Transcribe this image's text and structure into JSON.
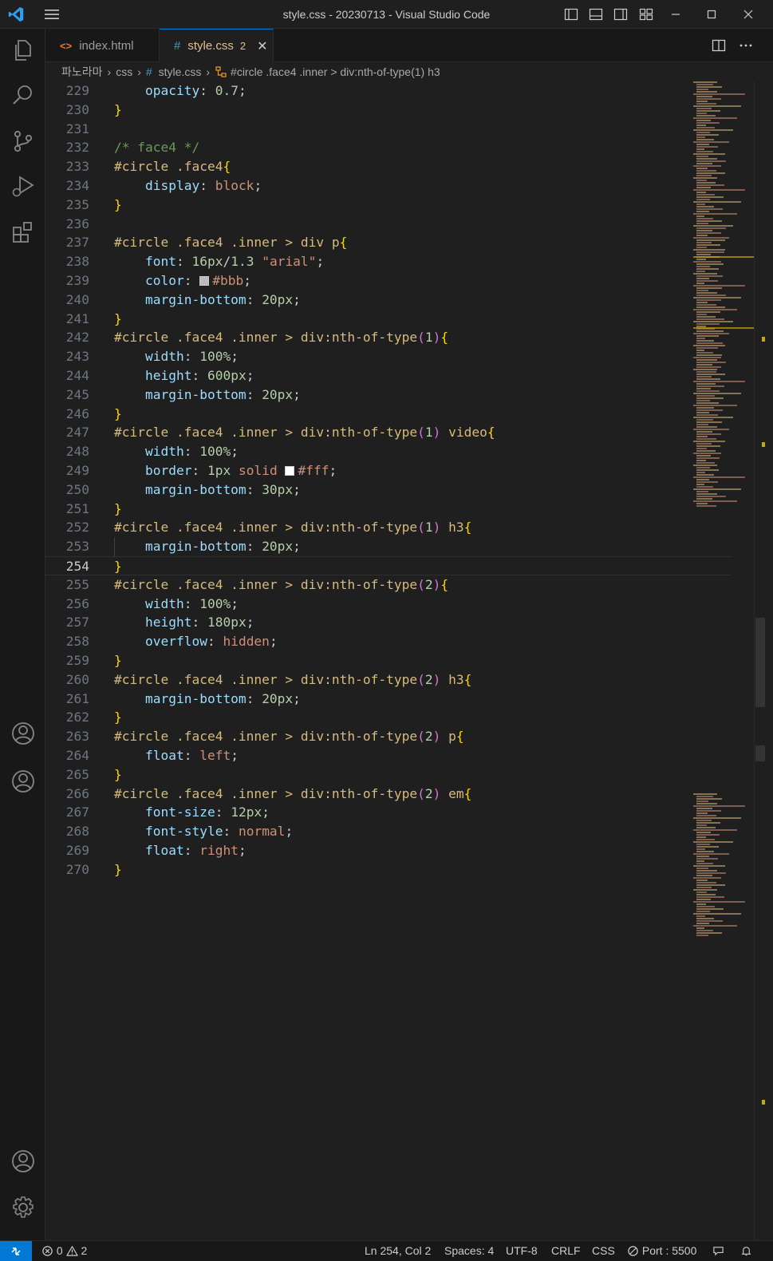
{
  "window": {
    "title": "style.css - 20230713 - Visual Studio Code"
  },
  "tabs": [
    {
      "label": "index.html",
      "icon": "html-file-icon"
    },
    {
      "label": "style.css",
      "icon": "css-file-icon",
      "problems": "2",
      "active": true
    }
  ],
  "breadcrumb": {
    "items": [
      "파노라마",
      "css",
      "style.css",
      "#circle .face4 .inner > div:nth-of-type(1) h3"
    ]
  },
  "editor": {
    "current_line": "254",
    "lines": [
      {
        "n": "229"
      },
      {
        "n": "230"
      },
      {
        "n": "231"
      },
      {
        "n": "232"
      },
      {
        "n": "233"
      },
      {
        "n": "234"
      },
      {
        "n": "235"
      },
      {
        "n": "236"
      },
      {
        "n": "237"
      },
      {
        "n": "238"
      },
      {
        "n": "239"
      },
      {
        "n": "240"
      },
      {
        "n": "241"
      },
      {
        "n": "242"
      },
      {
        "n": "243"
      },
      {
        "n": "244"
      },
      {
        "n": "245"
      },
      {
        "n": "246"
      },
      {
        "n": "247"
      },
      {
        "n": "248"
      },
      {
        "n": "249"
      },
      {
        "n": "250"
      },
      {
        "n": "251"
      },
      {
        "n": "252"
      },
      {
        "n": "253"
      },
      {
        "n": "254"
      },
      {
        "n": "255"
      },
      {
        "n": "256"
      },
      {
        "n": "257"
      },
      {
        "n": "258"
      },
      {
        "n": "259"
      },
      {
        "n": "260"
      },
      {
        "n": "261"
      },
      {
        "n": "262"
      },
      {
        "n": "263"
      },
      {
        "n": "264"
      },
      {
        "n": "265"
      },
      {
        "n": "266"
      },
      {
        "n": "267"
      },
      {
        "n": "268"
      },
      {
        "n": "269"
      },
      {
        "n": "270"
      }
    ],
    "code": [
      [
        [
          "prop",
          "    opacity"
        ],
        [
          "punc",
          ": "
        ],
        [
          "num",
          "0.7"
        ],
        [
          "punc",
          ";"
        ]
      ],
      [
        [
          "brace",
          "}"
        ]
      ],
      [],
      [
        [
          "cmt",
          "/* face4 */"
        ]
      ],
      [
        [
          "sel",
          "#circle .face4"
        ],
        [
          "brace",
          "{"
        ]
      ],
      [
        [
          "prop",
          "    display"
        ],
        [
          "punc",
          ": "
        ],
        [
          "kw",
          "block"
        ],
        [
          "punc",
          ";"
        ]
      ],
      [
        [
          "brace",
          "}"
        ]
      ],
      [],
      [
        [
          "sel",
          "#circle .face4 .inner > div p"
        ],
        [
          "brace",
          "{"
        ]
      ],
      [
        [
          "prop",
          "    font"
        ],
        [
          "punc",
          ": "
        ],
        [
          "num",
          "16px"
        ],
        [
          "punc",
          "/"
        ],
        [
          "num",
          "1.3"
        ],
        [
          "punc",
          " "
        ],
        [
          "str",
          "\"arial\""
        ],
        [
          "punc",
          ";"
        ]
      ],
      [
        [
          "prop",
          "    color"
        ],
        [
          "punc",
          ": "
        ],
        [
          "swatch",
          "#bbbbbb"
        ],
        [
          "str",
          "#bbb"
        ],
        [
          "punc",
          ";"
        ]
      ],
      [
        [
          "prop",
          "    margin-bottom"
        ],
        [
          "punc",
          ": "
        ],
        [
          "num",
          "20px"
        ],
        [
          "punc",
          ";"
        ]
      ],
      [
        [
          "brace",
          "}"
        ]
      ],
      [
        [
          "sel",
          "#circle .face4 .inner > div:nth-of-type"
        ],
        [
          "paren",
          "("
        ],
        [
          "num",
          "1"
        ],
        [
          "paren",
          ")"
        ],
        [
          "brace",
          "{"
        ]
      ],
      [
        [
          "prop",
          "    width"
        ],
        [
          "punc",
          ": "
        ],
        [
          "num",
          "100%"
        ],
        [
          "punc",
          ";"
        ]
      ],
      [
        [
          "prop",
          "    height"
        ],
        [
          "punc",
          ": "
        ],
        [
          "num",
          "600px"
        ],
        [
          "punc",
          ";"
        ]
      ],
      [
        [
          "prop",
          "    margin-bottom"
        ],
        [
          "punc",
          ": "
        ],
        [
          "num",
          "20px"
        ],
        [
          "punc",
          ";"
        ]
      ],
      [
        [
          "brace",
          "}"
        ]
      ],
      [
        [
          "sel",
          "#circle .face4 .inner > div:nth-of-type"
        ],
        [
          "paren",
          "("
        ],
        [
          "num",
          "1"
        ],
        [
          "paren",
          ")"
        ],
        [
          "sel",
          " video"
        ],
        [
          "brace",
          "{"
        ]
      ],
      [
        [
          "prop",
          "    width"
        ],
        [
          "punc",
          ": "
        ],
        [
          "num",
          "100%"
        ],
        [
          "punc",
          ";"
        ]
      ],
      [
        [
          "prop",
          "    border"
        ],
        [
          "punc",
          ": "
        ],
        [
          "num",
          "1px"
        ],
        [
          "punc",
          " "
        ],
        [
          "kw",
          "solid"
        ],
        [
          "punc",
          " "
        ],
        [
          "swatch",
          "#ffffff"
        ],
        [
          "str",
          "#fff"
        ],
        [
          "punc",
          ";"
        ]
      ],
      [
        [
          "prop",
          "    margin-bottom"
        ],
        [
          "punc",
          ": "
        ],
        [
          "num",
          "30px"
        ],
        [
          "punc",
          ";"
        ]
      ],
      [
        [
          "brace",
          "}"
        ]
      ],
      [
        [
          "sel",
          "#circle .face4 .inner > div:nth-of-type"
        ],
        [
          "paren",
          "("
        ],
        [
          "num",
          "1"
        ],
        [
          "paren",
          ")"
        ],
        [
          "sel",
          " h3"
        ],
        [
          "brace",
          "{"
        ]
      ],
      [
        [
          "prop",
          "    margin-bottom"
        ],
        [
          "punc",
          ": "
        ],
        [
          "num",
          "20px"
        ],
        [
          "punc",
          ";"
        ]
      ],
      [
        [
          "brace",
          "}"
        ]
      ],
      [
        [
          "sel",
          "#circle .face4 .inner > div:nth-of-type"
        ],
        [
          "paren",
          "("
        ],
        [
          "num",
          "2"
        ],
        [
          "paren",
          ")"
        ],
        [
          "brace",
          "{"
        ]
      ],
      [
        [
          "prop",
          "    width"
        ],
        [
          "punc",
          ": "
        ],
        [
          "num",
          "100%"
        ],
        [
          "punc",
          ";"
        ]
      ],
      [
        [
          "prop",
          "    height"
        ],
        [
          "punc",
          ": "
        ],
        [
          "num",
          "180px"
        ],
        [
          "punc",
          ";"
        ]
      ],
      [
        [
          "prop",
          "    overflow"
        ],
        [
          "punc",
          ": "
        ],
        [
          "kw",
          "hidden"
        ],
        [
          "punc",
          ";"
        ]
      ],
      [
        [
          "brace",
          "}"
        ]
      ],
      [
        [
          "sel",
          "#circle .face4 .inner > div:nth-of-type"
        ],
        [
          "paren",
          "("
        ],
        [
          "num",
          "2"
        ],
        [
          "paren",
          ")"
        ],
        [
          "sel",
          " h3"
        ],
        [
          "brace",
          "{"
        ]
      ],
      [
        [
          "prop",
          "    margin-bottom"
        ],
        [
          "punc",
          ": "
        ],
        [
          "num",
          "20px"
        ],
        [
          "punc",
          ";"
        ]
      ],
      [
        [
          "brace",
          "}"
        ]
      ],
      [
        [
          "sel",
          "#circle .face4 .inner > div:nth-of-type"
        ],
        [
          "paren",
          "("
        ],
        [
          "num",
          "2"
        ],
        [
          "paren",
          ")"
        ],
        [
          "sel",
          " p"
        ],
        [
          "brace",
          "{"
        ]
      ],
      [
        [
          "prop",
          "    float"
        ],
        [
          "punc",
          ": "
        ],
        [
          "kw",
          "left"
        ],
        [
          "punc",
          ";"
        ]
      ],
      [
        [
          "brace",
          "}"
        ]
      ],
      [
        [
          "sel",
          "#circle .face4 .inner > div:nth-of-type"
        ],
        [
          "paren",
          "("
        ],
        [
          "num",
          "2"
        ],
        [
          "paren",
          ")"
        ],
        [
          "sel",
          " em"
        ],
        [
          "brace",
          "{"
        ]
      ],
      [
        [
          "prop",
          "    font-size"
        ],
        [
          "punc",
          ": "
        ],
        [
          "num",
          "12px"
        ],
        [
          "punc",
          ";"
        ]
      ],
      [
        [
          "prop",
          "    font-style"
        ],
        [
          "punc",
          ": "
        ],
        [
          "kw",
          "normal"
        ],
        [
          "punc",
          ";"
        ]
      ],
      [
        [
          "prop",
          "    float"
        ],
        [
          "punc",
          ": "
        ],
        [
          "kw",
          "right"
        ],
        [
          "punc",
          ";"
        ]
      ],
      [
        [
          "brace",
          "}"
        ]
      ]
    ]
  },
  "statusbar": {
    "errors": "0",
    "warnings": "2",
    "position": "Ln 254, Col 2",
    "spaces": "Spaces: 4",
    "encoding": "UTF-8",
    "eol": "CRLF",
    "language": "CSS",
    "port": "Port : 5500"
  },
  "colors": {
    "accent": "#0078d4",
    "selector": "#d7ba7d",
    "property": "#9cdcfe",
    "number": "#b5cea8",
    "string": "#ce9178",
    "comment": "#6a9955",
    "brace": "#ffd700",
    "paren": "#da70d6",
    "modified_tab": "#e2c08d"
  },
  "icons": {
    "activity": [
      "explorer-icon",
      "search-icon",
      "source-control-icon",
      "run-debug-icon",
      "extensions-icon",
      "accounts-icon",
      "accounts-icon",
      "accounts-icon",
      "settings-gear-icon"
    ]
  }
}
